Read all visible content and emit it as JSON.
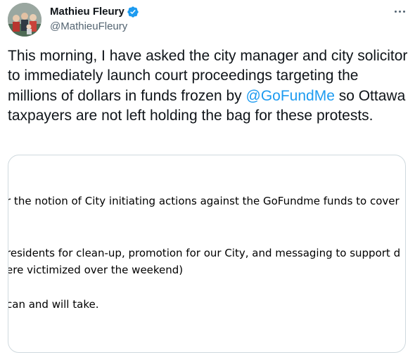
{
  "author": {
    "display_name": "Mathieu Fleury",
    "handle": "@MathieuFleury",
    "avatar_icon": "profile-photo",
    "verified_icon": "verified-badge-icon",
    "verified_color": "#1d9bf0"
  },
  "menu": {
    "icon": "more-options-icon"
  },
  "tweet": {
    "text_before": "This morning, I have asked the city manager and city solicitor to immediately launch court proceedings targeting the millions of dollars in funds frozen by ",
    "mention": "@GoFundMe",
    "text_after": " so Ottawa taxpayers are not left holding the bag for these protests."
  },
  "media": {
    "lines": [
      "r the notion of City initiating actions against the GoFundme funds to cover",
      "residents for clean-up, promotion for our City, and messaging to support d",
      "ere victimized over the weekend)",
      "can and will take."
    ]
  },
  "colors": {
    "text": "#0f1419",
    "secondary": "#536471",
    "link": "#1d9bf0",
    "border": "#cfd9de"
  }
}
